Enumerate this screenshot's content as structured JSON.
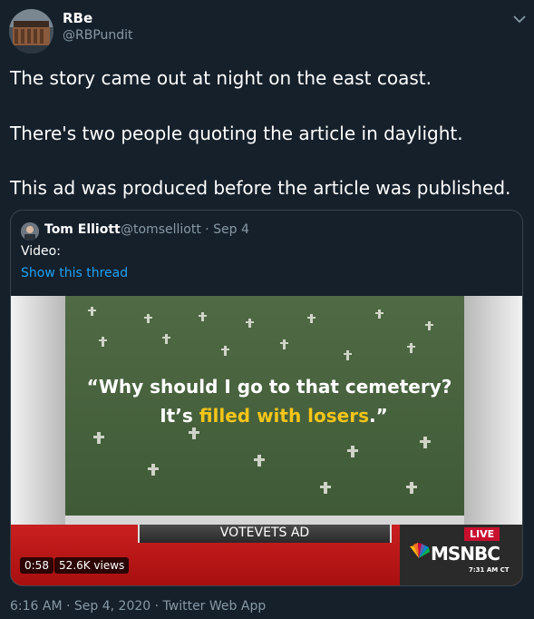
{
  "author": {
    "name": "RBe",
    "handle": "@RBPundit"
  },
  "tweet_lines": [
    "The story came out at night on the east coast.",
    "There's two people quoting the article in daylight.",
    "This ad was produced before the article was published."
  ],
  "quote": {
    "name": "Tom Elliott",
    "handle_date": "@tomselliott · Sep 4",
    "text": "Video:",
    "thread_link": "Show this thread"
  },
  "video": {
    "caption_line1": "“Why should I go to that cemetery?",
    "caption_line2_pre": "It’s ",
    "caption_line2_highlight": "filled with losers",
    "caption_line2_post": ".”",
    "banner": "VOTEVETS AD",
    "live": "LIVE",
    "network": "MSNBC",
    "clock": "7:31 AM CT",
    "duration": "0:58",
    "views": "52.6K views"
  },
  "timestamp": "6:16 AM · Sep 4, 2020 · Twitter Web App",
  "colors": {
    "background": "#15202b",
    "link": "#1da1f2",
    "secondary_text": "#8899a6",
    "highlight": "#f5c518"
  },
  "icons": {
    "menu": "chevron-down-icon",
    "network_logo": "peacock-icon"
  }
}
